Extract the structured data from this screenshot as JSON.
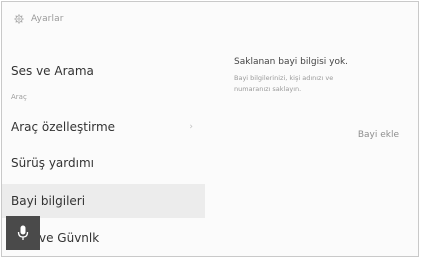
{
  "header": {
    "title": "Ayarlar",
    "icon": "gear-icon"
  },
  "sidebar": {
    "section_label": "Araç",
    "items": [
      {
        "label": "Ses ve Arama"
      },
      {
        "label": "Araç özelleştirme",
        "chevron": "›"
      },
      {
        "label": "Sürüş yardımı"
      },
      {
        "label": "Bayi bilgileri",
        "selected": true
      },
      {
        "label": "ve Güvnlk"
      }
    ]
  },
  "content": {
    "empty_title": "Saklanan bayi bilgisi yok.",
    "empty_description": "Bayi bilgilerinizi, kişi adınızı ve numaranızı saklayın.",
    "add_button_label": "Bayi ekle"
  },
  "voice": {
    "icon": "microphone-icon"
  }
}
